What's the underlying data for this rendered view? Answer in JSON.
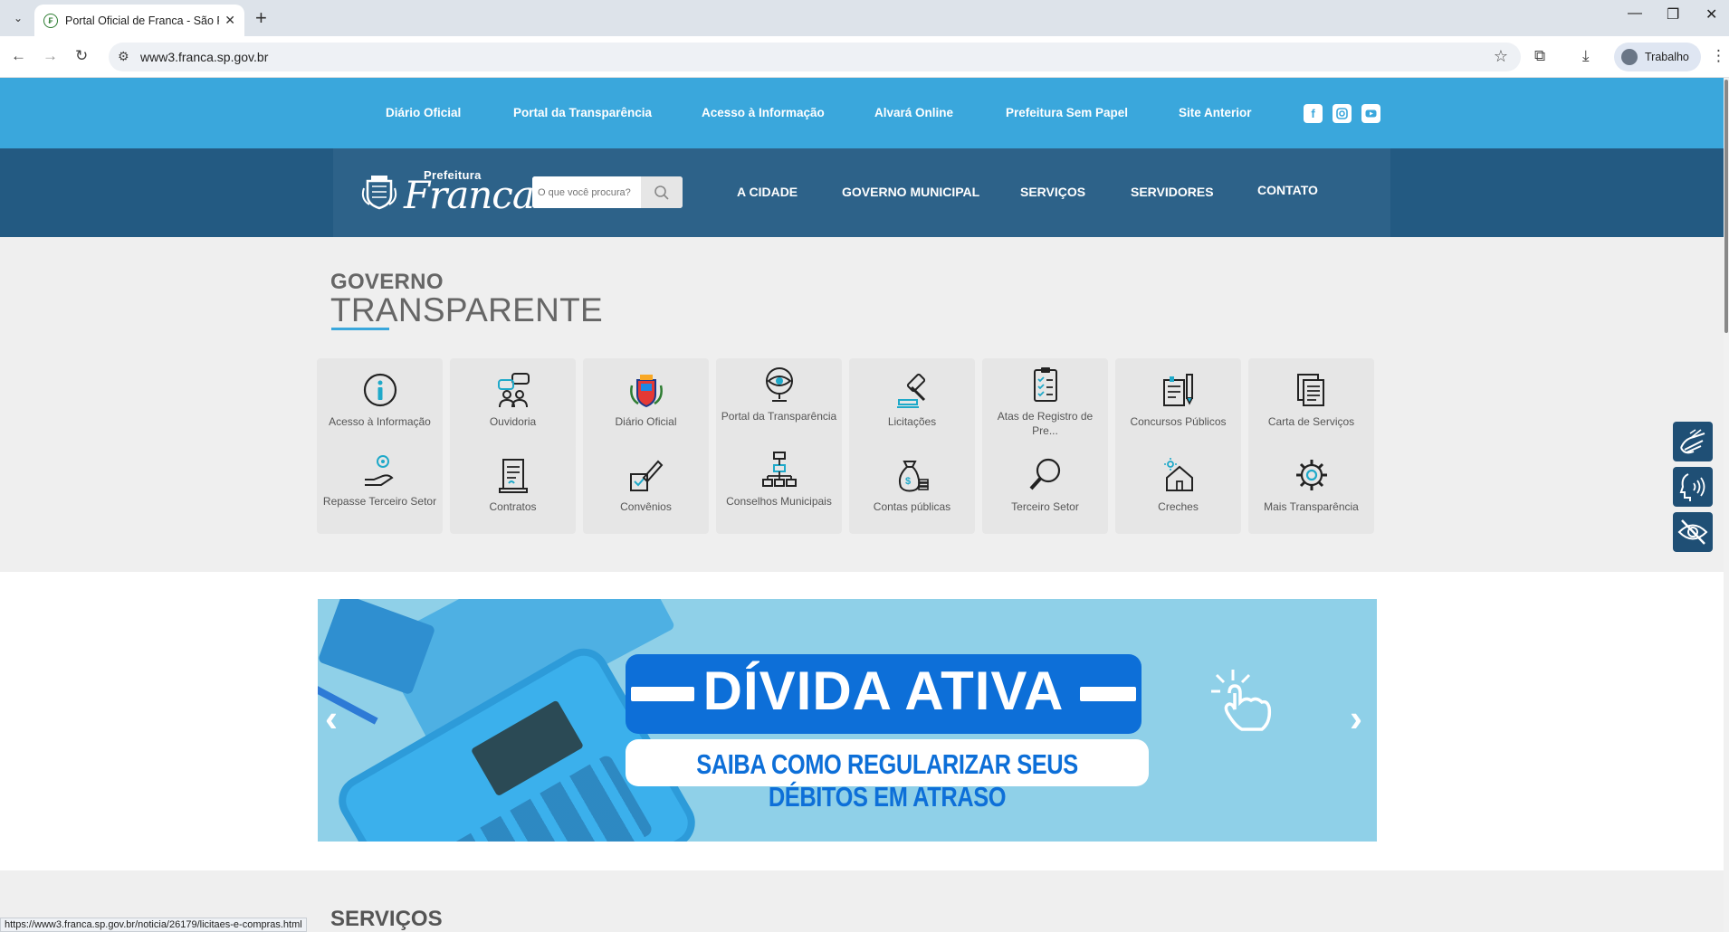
{
  "browser": {
    "tab_title": "Portal Oficial de Franca - São Pa",
    "url": "www3.franca.sp.gov.br",
    "profile_label": "Trabalho",
    "status_url": "https://www3.franca.sp.gov.br/noticia/26179/licitaes-e-compras.html"
  },
  "topbar": {
    "links": [
      "Diário Oficial",
      "Portal da Transparência",
      "Acesso à Informação",
      "Alvará Online",
      "Prefeitura Sem Papel",
      "Site Anterior"
    ],
    "social": [
      "facebook-icon",
      "instagram-icon",
      "youtube-icon"
    ]
  },
  "header": {
    "logo_small": "Prefeitura",
    "logo_big": "Franca",
    "search_placeholder": "O que você procura?",
    "nav": [
      "A CIDADE",
      "GOVERNO MUNICIPAL",
      "SERVIÇOS",
      "SERVIDORES",
      "CONTATO"
    ]
  },
  "governo": {
    "title_top": "GOVERNO",
    "title_bottom": "TRANSPARENTE",
    "tiles": [
      {
        "label": "Acesso à Informação",
        "icon": "info-icon"
      },
      {
        "label": "Ouvidoria",
        "icon": "ouvidoria-icon"
      },
      {
        "label": "Diário Oficial",
        "icon": "crest-icon"
      },
      {
        "label": "Portal da Transparência",
        "icon": "eye-globe-icon"
      },
      {
        "label": "Licitações",
        "icon": "gavel-icon"
      },
      {
        "label": "Atas de Registro de Pre...",
        "icon": "clipboard-icon"
      },
      {
        "label": "Concursos Públicos",
        "icon": "exam-icon"
      },
      {
        "label": "Carta de Serviços",
        "icon": "documents-icon"
      },
      {
        "label": "Repasse Terceiro Setor",
        "icon": "hand-gear-icon"
      },
      {
        "label": "Contratos",
        "icon": "contract-icon"
      },
      {
        "label": "Convênios",
        "icon": "pen-check-icon"
      },
      {
        "label": "Conselhos Municipais",
        "icon": "org-chart-icon"
      },
      {
        "label": "Contas públicas",
        "icon": "money-bag-icon"
      },
      {
        "label": "Terceiro Setor",
        "icon": "magnifier-icon"
      },
      {
        "label": "Creches",
        "icon": "house-sun-icon"
      },
      {
        "label": "Mais Transparência",
        "icon": "gear-icon"
      }
    ]
  },
  "banner": {
    "headline": "DÍVIDA ATIVA",
    "subline": "SAIBA COMO REGULARIZAR SEUS DÉBITOS EM ATRASO",
    "prev": "‹",
    "next": "›"
  },
  "servicos": {
    "title": "SERVIÇOS"
  },
  "colors": {
    "topbar": "#3aa7dc",
    "nav": "#2d6289",
    "accent": "#0d6fd8"
  }
}
